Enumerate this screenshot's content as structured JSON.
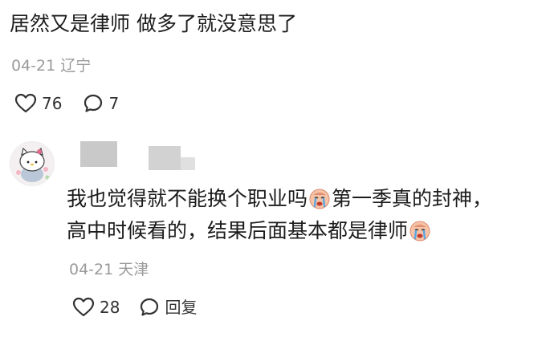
{
  "comment1": {
    "text": "居然又是律师 做多了就没意思了",
    "date": "04-21",
    "location": "辽宁",
    "likes": "76",
    "replies": "7"
  },
  "comment2": {
    "line1_a": "我也觉得就不能换个职业吗",
    "line1_emoji": "crying-face-emoji",
    "line1_b": "第一季真的封神，",
    "line2_a": "高中时候看的，结果后面基本都是律师",
    "line2_emoji": "crying-face-emoji",
    "date": "04-21",
    "location": "天津",
    "likes": "28",
    "reply_label": "回复"
  },
  "icons": {
    "like": "heart-icon",
    "comment": "comment-bubble-icon",
    "avatar": "hello-kitty-avatar"
  },
  "colors": {
    "text": "#1c1c1c",
    "meta": "#9a9a9a",
    "icon": "#333333",
    "blur": "#c9c9c9"
  }
}
